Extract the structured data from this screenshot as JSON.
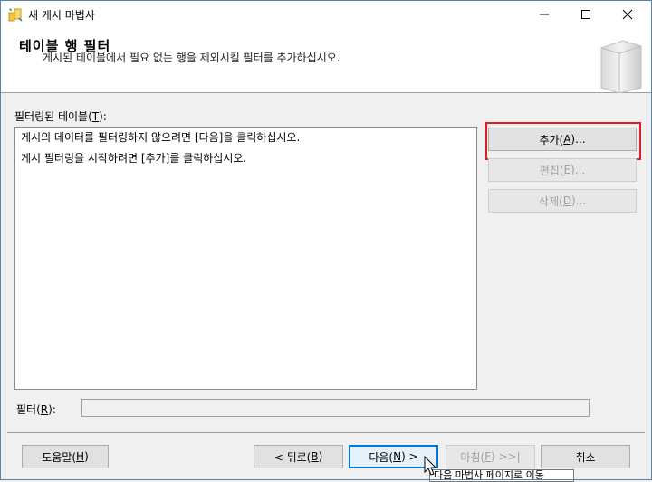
{
  "window": {
    "title": "새 게시 마법사"
  },
  "header": {
    "title": "테이블 행 필터",
    "subtitle": "게시된 테이블에서 필요 없는 행을 제외시킬 필터를 추가하십시오."
  },
  "filtered_tables": {
    "label": "필터링된 테이블(",
    "mnemonic": "T",
    "label_end": "):",
    "lines": [
      "게시의 데이터를 필터링하지 않으려면 [다음]을 클릭하십시오.",
      "게시 필터링을 시작하려면 [추가]를 클릭하십시오."
    ]
  },
  "buttons": {
    "add": {
      "pre": "추가(",
      "key": "A",
      "post": ")..."
    },
    "edit": {
      "pre": "편집(",
      "key": "E",
      "post": ")..."
    },
    "delete": {
      "pre": "삭제(",
      "key": "D",
      "post": ")..."
    },
    "help": {
      "pre": "도움말(",
      "key": "H",
      "post": ")"
    },
    "back": {
      "pre": "< 뒤로(",
      "key": "B",
      "post": ")"
    },
    "next": {
      "pre": "다음(",
      "key": "N",
      "post": ") >"
    },
    "finish": {
      "pre": "마침(",
      "key": "F",
      "post": ") >>|"
    },
    "cancel": {
      "label": "취소"
    }
  },
  "filter": {
    "pre": "필터(",
    "key": "R",
    "post": "):",
    "value": ""
  },
  "tooltip": "다음 마법사 페이지로 이동",
  "colors": {
    "highlight": "#e01b24",
    "accent": "#0078d7"
  }
}
